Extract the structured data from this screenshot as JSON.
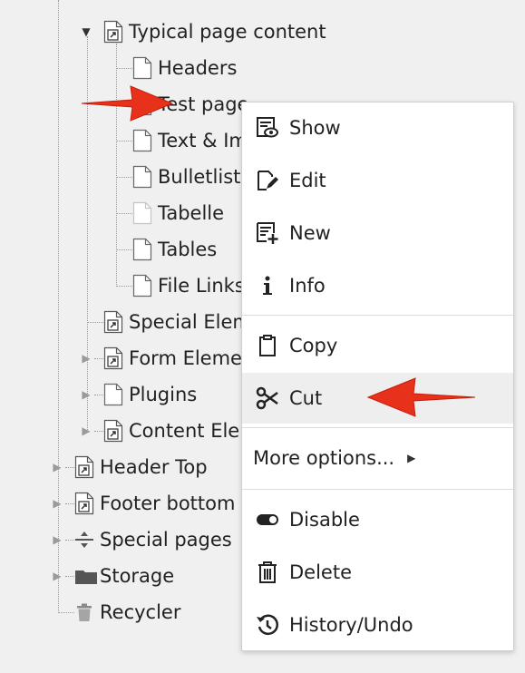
{
  "tree": {
    "items": [
      {
        "label": "Typical page content"
      },
      {
        "label": "Headers"
      },
      {
        "label": "Test page"
      },
      {
        "label": "Text & Images"
      },
      {
        "label": "Bulletlists"
      },
      {
        "label": "Tabelle"
      },
      {
        "label": "Tables"
      },
      {
        "label": "File Links"
      },
      {
        "label": "Special Elements"
      },
      {
        "label": "Form Elements"
      },
      {
        "label": "Plugins"
      },
      {
        "label": "Content Elements"
      },
      {
        "label": "Header Top"
      },
      {
        "label": "Footer bottom"
      },
      {
        "label": "Special pages"
      },
      {
        "label": "Storage"
      },
      {
        "label": "Recycler"
      }
    ]
  },
  "context_menu": {
    "show": "Show",
    "edit": "Edit",
    "new": "New",
    "info": "Info",
    "copy": "Copy",
    "cut": "Cut",
    "more_options": "More options...",
    "disable": "Disable",
    "delete": "Delete",
    "history": "History/Undo"
  },
  "colors": {
    "arrow": "#e8311b",
    "background": "#f0f0f0"
  }
}
